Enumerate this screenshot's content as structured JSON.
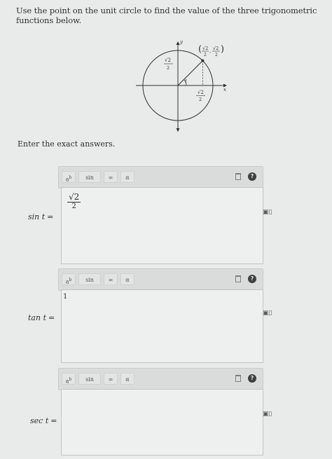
{
  "prompt": "Use the point on the unit circle to find the value of the three trigonometric functions below.",
  "figure": {
    "axis_x_label": "x",
    "axis_y_label": "y",
    "point_label_x": "√2",
    "point_label_x_den": "2",
    "point_label_y": "√2",
    "point_label_y_den": "2",
    "vertical_label_num": "√2",
    "vertical_label_den": "2",
    "horizontal_label_num": "√2",
    "horizontal_label_den": "2",
    "angle_label": "t"
  },
  "enter_text": "Enter the exact answers.",
  "toolbar": {
    "power_label": "a",
    "power_sup": "b",
    "sin_label": "sin (a)",
    "infinity_label": "∞",
    "alpha_label": "α",
    "help_label": "?"
  },
  "answers": [
    {
      "fn": "sin",
      "var": "t",
      "eq": "=",
      "value_num": "√2",
      "value_den": "2"
    },
    {
      "fn": "tan",
      "var": "t",
      "eq": "=",
      "value": "1"
    },
    {
      "fn": "sec",
      "var": "t",
      "eq": "=",
      "value": ""
    }
  ]
}
